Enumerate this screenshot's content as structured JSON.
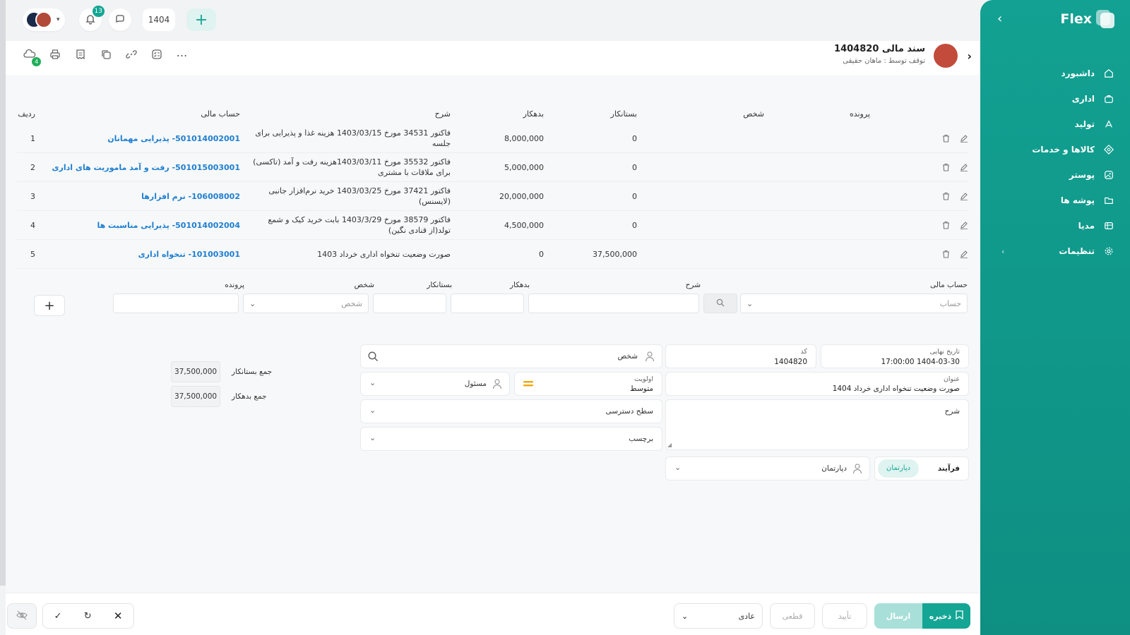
{
  "sidebar": {
    "brand": "Flex",
    "items": [
      {
        "label": "داشبورد",
        "icon": "home-icon"
      },
      {
        "label": "اداری",
        "icon": "briefcase-icon"
      },
      {
        "label": "تولید",
        "icon": "factory-icon"
      },
      {
        "label": "کالاها و خدمات",
        "icon": "box-icon"
      },
      {
        "label": "پوستر",
        "icon": "image-icon"
      },
      {
        "label": "پوشه ها",
        "icon": "folder-icon"
      },
      {
        "label": "مدیا",
        "icon": "media-icon"
      },
      {
        "label": "تنظیمات",
        "icon": "gear-icon"
      }
    ]
  },
  "topbar": {
    "notifications_count": "13",
    "year": "1404"
  },
  "header": {
    "title": "سند مالی 1404820",
    "subtitle": "توقف توسط : ماهان حقیقی",
    "attachments_count": "4"
  },
  "table": {
    "headers": {
      "index": "ردیف",
      "account": "حساب مالی",
      "description": "شرح",
      "debit": "بدهکار",
      "credit": "بستانکار",
      "person": "شخص",
      "file": "پرونده"
    },
    "rows": [
      {
        "index": "1",
        "account": "501014002001- پذیرایی مهمانان",
        "description": "فاکتور 34531 مورخ 1403/03/15 هزینه غذا و پذیرایی برای جلسه",
        "debit": "8,000,000",
        "credit": "0"
      },
      {
        "index": "2",
        "account": "501015003001- رفت و آمد ماموریت های اداری",
        "description": "فاکتور 35532 مورخ 1403/03/11هزینه رفت و آمد (تاکسی) برای ملاقات با مشتری",
        "debit": "5,000,000",
        "credit": "0"
      },
      {
        "index": "3",
        "account": "106008002- نرم افزارها",
        "description": "فاکتور 37421 مورخ 1403/03/25 خرید نرم‌افزار جانبی (لایسنس)",
        "debit": "20,000,000",
        "credit": "0"
      },
      {
        "index": "4",
        "account": "501014002004- پذیرایی مناسبت ها",
        "description": "فاکتور 38579 مورخ 1403/3/29 بابت خرید کیک و شمع تولد(از قنادی نگین)",
        "debit": "4,500,000",
        "credit": "0"
      },
      {
        "index": "5",
        "account": "101003001- تنخواه اداری",
        "description": "صورت وضعیت تنخواه اداری خرداد 1403",
        "debit": "0",
        "credit": "37,500,000"
      }
    ]
  },
  "entry": {
    "account_label": "حساب مالی",
    "account_placeholder": "حساب",
    "desc_label": "شرح",
    "debit_label": "بدهکار",
    "credit_label": "بستانکار",
    "person_label": "شخص",
    "person_placeholder": "شخص",
    "file_label": "پرونده"
  },
  "form": {
    "final_date_label": "تاریخ نهایی",
    "final_date_value": "1404-03-30 17:00:00",
    "code_label": "کد",
    "code_value": "1404820",
    "person_placeholder": "شخص",
    "title_label": "عنوان",
    "title_value": "صورت وضعیت تنخواه اداری خرداد 1404",
    "priority_label": "اولویت",
    "priority_value": "متوسط",
    "responsible_placeholder": "مسئول",
    "description_label": "شرح",
    "access_level_placeholder": "سطح دسترسی",
    "tag_placeholder": "برچسب",
    "process_label": "فرآیند",
    "department_chip": "دپارتمان",
    "department_placeholder": "دپارتمان"
  },
  "totals": {
    "credit_label": "جمع بستانکار",
    "credit_value": "37,500,000",
    "debit_label": "جمع بدهکار",
    "debit_value": "37,500,000"
  },
  "bottombar": {
    "save_label": "ذخیره",
    "send_label": "ارسال",
    "confirm_label": "تأیید",
    "final_label": "قطعی",
    "status_value": "عادی"
  },
  "colors": {
    "primary": "#14a594",
    "link": "#1e7fd1",
    "priority": "#f0a500"
  }
}
